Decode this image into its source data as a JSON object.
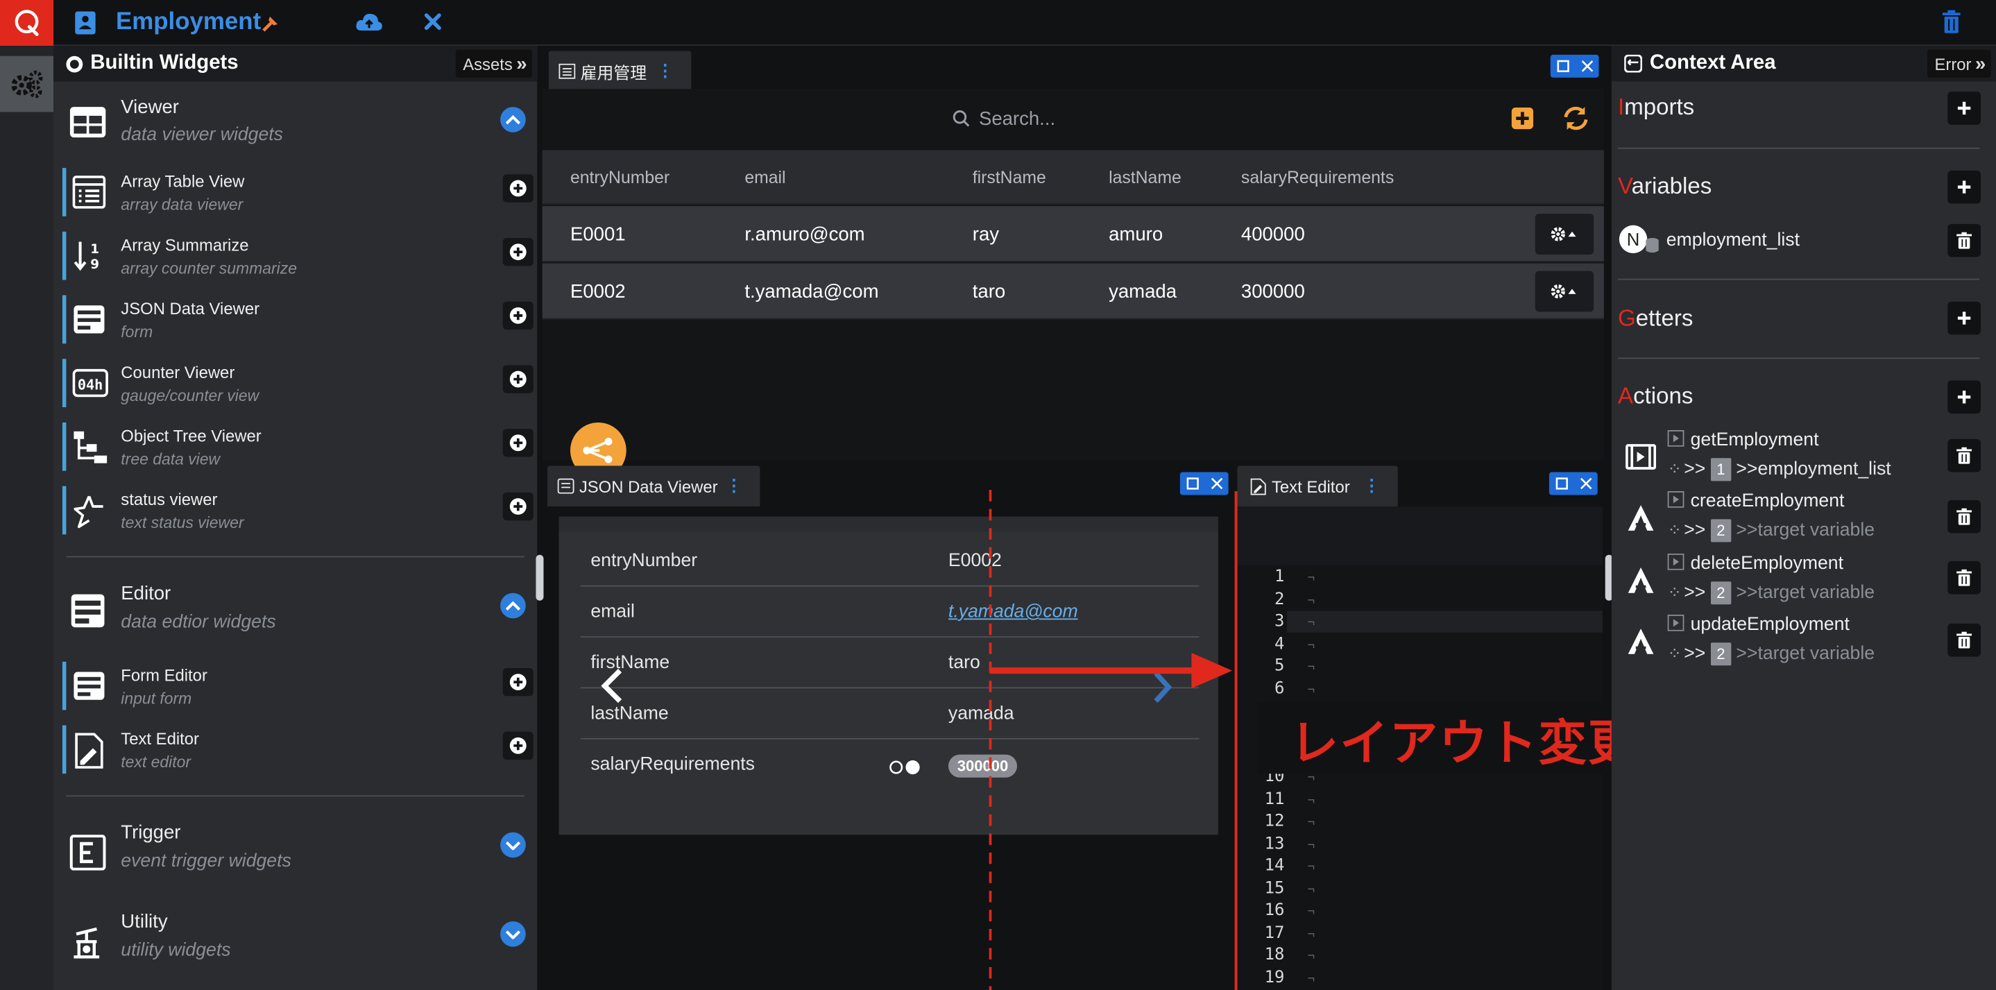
{
  "app": {
    "title": "Employment",
    "colors": {
      "accent": "#3a8ee6",
      "brand": "#e0281d",
      "orange": "#f3a33a",
      "annotation": "#e0281d"
    }
  },
  "left_panel": {
    "title": "Builtin Widgets",
    "tab": "Assets",
    "categories": [
      {
        "name": "Viewer",
        "desc": "data viewer widgets",
        "icon": "table-icon",
        "expanded": true
      },
      {
        "name": "Editor",
        "desc": "data edtior widgets",
        "icon": "form-icon",
        "expanded": true
      },
      {
        "name": "Trigger",
        "desc": "event trigger widgets",
        "icon": "trigger-icon",
        "expanded": false
      },
      {
        "name": "Utility",
        "desc": "utility widgets",
        "icon": "pump-icon",
        "expanded": false
      }
    ],
    "viewer_items": [
      {
        "name": "Array Table View",
        "desc": "array data viewer"
      },
      {
        "name": "Array Summarize",
        "desc": "array counter summarize"
      },
      {
        "name": "JSON Data Viewer",
        "desc": "form"
      },
      {
        "name": "Counter Viewer",
        "desc": "gauge/counter view"
      },
      {
        "name": "Object Tree Viewer",
        "desc": "tree data view"
      },
      {
        "name": "status viewer",
        "desc": "text status viewer"
      }
    ],
    "editor_items": [
      {
        "name": "Form Editor",
        "desc": "input form"
      },
      {
        "name": "Text Editor",
        "desc": "text editor"
      }
    ]
  },
  "table_widget": {
    "tab_label": "雇用管理",
    "search_placeholder": "Search...",
    "columns": [
      "entryNumber",
      "email",
      "firstName",
      "lastName",
      "salaryRequirements"
    ],
    "rows": [
      [
        "E0001",
        "r.amuro@com",
        "ray",
        "amuro",
        "400000"
      ],
      [
        "E0002",
        "t.yamada@com",
        "taro",
        "yamada",
        "300000"
      ]
    ]
  },
  "json_viewer": {
    "tab_label": "JSON Data Viewer",
    "fields": [
      {
        "key": "entryNumber",
        "value": "E0002"
      },
      {
        "key": "email",
        "value": "t.yamada@com"
      },
      {
        "key": "firstName",
        "value": "taro"
      },
      {
        "key": "lastName",
        "value": "yamada"
      },
      {
        "key": "salaryRequirements",
        "value": "300000"
      }
    ]
  },
  "text_editor": {
    "tab_label": "Text Editor",
    "line_numbers": [
      "1",
      "2",
      "3",
      "4",
      "5",
      "6",
      "10",
      "11",
      "12",
      "13",
      "14",
      "15",
      "16",
      "17",
      "18",
      "19"
    ],
    "newline_mark": "¬"
  },
  "annotation": {
    "text": "レイアウト変更後"
  },
  "context": {
    "title": "Context Area",
    "tab": "Error",
    "sections": {
      "imports": {
        "first": "I",
        "rest": "mports"
      },
      "variables": {
        "first": "V",
        "rest": "ariables"
      },
      "getters": {
        "first": "G",
        "rest": "etters"
      },
      "actions": {
        "first": "A",
        "rest": "ctions"
      }
    },
    "variable": {
      "badge": "N",
      "name": "employment_list"
    },
    "actions": [
      {
        "name": "getEmployment",
        "arrow": ">>",
        "num": "1",
        "target": ">>employment_list"
      },
      {
        "name": "createEmployment",
        "arrow": ">>",
        "num": "2",
        "target": ">>target variable"
      },
      {
        "name": "deleteEmployment",
        "arrow": ">>",
        "num": "2",
        "target": ">>target variable"
      },
      {
        "name": "updateEmployment",
        "arrow": ">>",
        "num": "2",
        "target": ">>target variable"
      }
    ]
  }
}
